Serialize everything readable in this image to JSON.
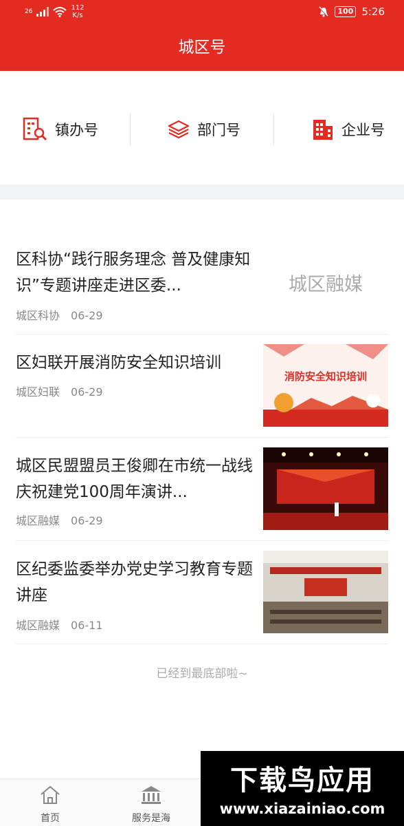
{
  "status_bar": {
    "network": "26",
    "speed_value": "112",
    "speed_unit": "K/s",
    "battery": "100",
    "time": "5:26"
  },
  "header": {
    "title": "城区号"
  },
  "nav": [
    {
      "label": "镇办号",
      "icon": "building-search-icon"
    },
    {
      "label": "部门号",
      "icon": "layers-icon"
    },
    {
      "label": "企业号",
      "icon": "office-building-icon"
    }
  ],
  "articles": [
    {
      "title": "区科协“践行服务理念 普及健康知识”专题讲座走进区委...",
      "source": "城区科协",
      "date": "06-29",
      "thumb_text": "城区融媒"
    },
    {
      "title": "区妇联开展消防安全知识培训",
      "source": "城区妇联",
      "date": "06-29",
      "thumb_text": "消防安全知识培训"
    },
    {
      "title": "城区民盟盟员王俊卿在市统一战线庆祝建党100周年演讲...",
      "source": "城区融媒",
      "date": "06-29"
    },
    {
      "title": "区纪委监委举办党史学习教育专题讲座",
      "source": "城区融媒",
      "date": "06-11"
    }
  ],
  "end_note": "已经到最底部啦~",
  "tabbar": [
    {
      "label": "首页",
      "icon": "home-icon"
    },
    {
      "label": "服务是海",
      "icon": "bank-icon"
    }
  ],
  "watermark": {
    "title": "下载鸟应用",
    "url": "www.xiazainiao.com"
  },
  "colors": {
    "brand_red": "#e32b21",
    "meta_gray": "#888888"
  }
}
